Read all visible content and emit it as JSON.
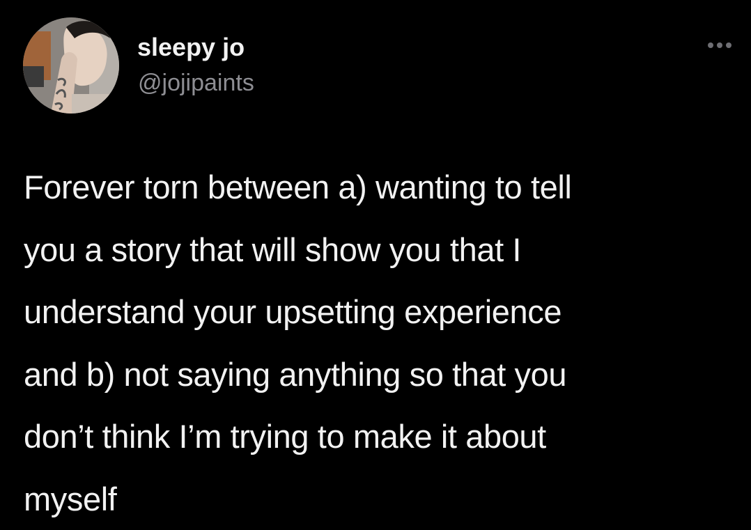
{
  "author": {
    "display_name": "sleepy jo",
    "handle": "@jojipaints",
    "avatar_icon": "profile-photo-avatar"
  },
  "more_icon": "ellipsis-icon",
  "tweet": {
    "lines": [
      "Forever torn between a) wanting to tell",
      "you a story that will show you that I",
      "understand your upsetting experience",
      "and b) not saying anything so that you",
      "don’t think I’m trying to make it about",
      "myself"
    ]
  },
  "colors": {
    "background": "#000000",
    "text": "#f2f2f2",
    "secondary_text": "#8e8e93"
  }
}
